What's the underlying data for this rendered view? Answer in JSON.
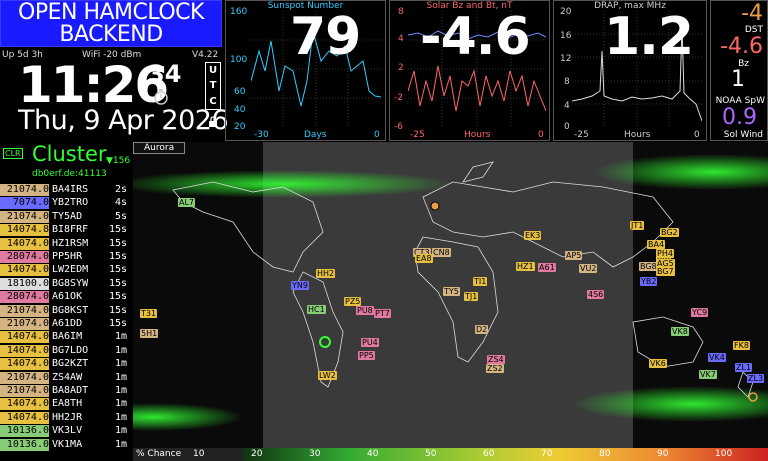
{
  "header": {
    "title_line1": "OPEN HAMCLOCK",
    "title_line2": "BACKEND"
  },
  "status": {
    "uptime": "Up  5d  3h",
    "wifi": "WiFi  -20 dBm",
    "version": "V4.22"
  },
  "clock": {
    "time": "11:26",
    "seconds": "34",
    "date": "Thu, 9 Apr 2026",
    "tz": [
      "U",
      "T",
      "C"
    ]
  },
  "sunspot": {
    "title": "Sunspot Number",
    "value": "79",
    "y_ticks": [
      "160",
      "100",
      "60",
      "40",
      "20"
    ],
    "x_ticks": [
      "-30",
      "Days",
      "0"
    ],
    "chart_data": {
      "type": "line",
      "x": [
        -30,
        -27,
        -24,
        -21,
        -18,
        -15,
        -12,
        -9,
        -6,
        -3,
        0
      ],
      "values": [
        95,
        110,
        140,
        65,
        55,
        100,
        150,
        120,
        110,
        40,
        35
      ],
      "ylim": [
        20,
        160
      ]
    }
  },
  "solarwind_bz": {
    "title": "Solar Bz and Bt, nT",
    "value": "-4.6",
    "y_ticks": [
      "8",
      "4",
      "2",
      "-2",
      "-6"
    ],
    "x_ticks": [
      "-25",
      "Hours",
      "0"
    ],
    "chart_data": {
      "type": "line",
      "series": [
        {
          "values": [
            5,
            5.5,
            4.8,
            5.2,
            5.6,
            5,
            4.9,
            5.3,
            5.1,
            5.4,
            5.2
          ]
        },
        {
          "values": [
            -1,
            2,
            -3,
            0,
            1,
            -4,
            2,
            -2,
            -1,
            0,
            -4.6
          ]
        }
      ],
      "ylim": [
        -6,
        8
      ]
    }
  },
  "drap": {
    "title": "DRAP, max MHz",
    "value": "1.2",
    "y_ticks": [
      "20",
      "16",
      "12",
      "8",
      "4",
      "0"
    ],
    "x_ticks": [
      "-25",
      "Hours",
      "0"
    ],
    "chart_data": {
      "type": "line",
      "values": [
        5,
        6,
        7,
        4,
        14,
        6,
        5,
        4,
        18,
        5,
        1.2
      ],
      "ylim": [
        0,
        20
      ]
    }
  },
  "space_wx": {
    "dst": "-4",
    "dst_label": "DST",
    "bz": "-4.6",
    "bz_label": "Bz",
    "noaa": "1",
    "noaa_label": "NOAA SpW",
    "wind": "0.9",
    "wind_label": "Sol Wind"
  },
  "cluster": {
    "clr": "CLR",
    "title": "Cluster",
    "count": "▼156",
    "host": "db0erf.de:41113",
    "spots": [
      {
        "freq": "21074.0",
        "call": "BA4IRS",
        "age": "2s",
        "color": "#d4b483"
      },
      {
        "freq": "7074.0",
        "call": "YB2TRO",
        "age": "4s",
        "color": "#6b6bff"
      },
      {
        "freq": "21074.0",
        "call": "TY5AD",
        "age": "5s",
        "color": "#d4b483"
      },
      {
        "freq": "14074.8",
        "call": "BI8FRF",
        "age": "15s",
        "color": "#e8c040"
      },
      {
        "freq": "14074.0",
        "call": "HZ1RSM",
        "age": "15s",
        "color": "#e8c040"
      },
      {
        "freq": "28074.0",
        "call": "PP5HR",
        "age": "15s",
        "color": "#e07aa0"
      },
      {
        "freq": "14074.0",
        "call": "LW2EDM",
        "age": "15s",
        "color": "#e8c040"
      },
      {
        "freq": "18100.0",
        "call": "BG8SYW",
        "age": "15s",
        "color": "#dddddd"
      },
      {
        "freq": "28074.0",
        "call": "A61OK",
        "age": "15s",
        "color": "#e07aa0"
      },
      {
        "freq": "21074.0",
        "call": "BG8KST",
        "age": "15s",
        "color": "#d4b483"
      },
      {
        "freq": "21074.0",
        "call": "A61DD",
        "age": "15s",
        "color": "#d4b483"
      },
      {
        "freq": "14074.0",
        "call": "BA6IM",
        "age": "1m",
        "color": "#e8c040"
      },
      {
        "freq": "14074.0",
        "call": "BG7LDO",
        "age": "1m",
        "color": "#e8c040"
      },
      {
        "freq": "14074.0",
        "call": "BG2KZT",
        "age": "1m",
        "color": "#e8c040"
      },
      {
        "freq": "21074.0",
        "call": "ZS4AW",
        "age": "1m",
        "color": "#d4b483"
      },
      {
        "freq": "21074.0",
        "call": "BA8ADT",
        "age": "1m",
        "color": "#d4b483"
      },
      {
        "freq": "14074.0",
        "call": "EA8TH",
        "age": "1m",
        "color": "#e8c040"
      },
      {
        "freq": "14074.0",
        "call": "HH2JR",
        "age": "1m",
        "color": "#e8c040"
      },
      {
        "freq": "10136.0",
        "call": "VK3LV",
        "age": "1m",
        "color": "#88cc77"
      },
      {
        "freq": "10136.0",
        "call": "VK1MA",
        "age": "1m",
        "color": "#88cc77"
      }
    ]
  },
  "map": {
    "mode": "Aurora",
    "labels": [
      {
        "t": "AL7",
        "c": "#88cc77"
      },
      {
        "t": "JT1",
        "c": "#e8c040"
      },
      {
        "t": "BG2",
        "c": "#e8c040"
      },
      {
        "t": "BA4",
        "c": "#e8c040"
      },
      {
        "t": "BG8",
        "c": "#d4b483"
      },
      {
        "t": "BI8",
        "c": "#e8c040"
      },
      {
        "t": "PH4",
        "c": "#e8c040"
      },
      {
        "t": "AG5",
        "c": "#e8c040"
      },
      {
        "t": "BG7",
        "c": "#e8c040"
      },
      {
        "t": "YB2",
        "c": "#6b6bff"
      },
      {
        "t": "YC9",
        "c": "#e07aa0"
      },
      {
        "t": "AP5",
        "c": "#d4b483"
      },
      {
        "t": "VU2",
        "c": "#d4b483"
      },
      {
        "t": "HZ1",
        "c": "#e8c040"
      },
      {
        "t": "A61",
        "c": "#e07aa0"
      },
      {
        "t": "EK3",
        "c": "#e8c040"
      },
      {
        "t": "CT3",
        "c": "#d4b483"
      },
      {
        "t": "CN8",
        "c": "#d4b483"
      },
      {
        "t": "EA8",
        "c": "#e8c040"
      },
      {
        "t": "TY5",
        "c": "#d4b483"
      },
      {
        "t": "TJ1",
        "c": "#e8c040"
      },
      {
        "t": "TI1",
        "c": "#e8c040"
      },
      {
        "t": "D2",
        "c": "#d4b483"
      },
      {
        "t": "ZS4",
        "c": "#e07aa0"
      },
      {
        "t": "ZS2",
        "c": "#d4b483"
      },
      {
        "t": "4S6",
        "c": "#e07aa0"
      },
      {
        "t": "VK8",
        "c": "#88cc77"
      },
      {
        "t": "VK6",
        "c": "#e8c040"
      },
      {
        "t": "FK8",
        "c": "#e8c040"
      },
      {
        "t": "VK4",
        "c": "#6b6bff"
      },
      {
        "t": "VK7",
        "c": "#88cc77"
      },
      {
        "t": "ZL1",
        "c": "#6b6bff"
      },
      {
        "t": "ZL3",
        "c": "#6b6bff"
      },
      {
        "t": "PU8",
        "c": "#e07aa0"
      },
      {
        "t": "PT7",
        "c": "#e07aa0"
      },
      {
        "t": "PU4",
        "c": "#e07aa0"
      },
      {
        "t": "PP5",
        "c": "#e07aa0"
      },
      {
        "t": "LW2",
        "c": "#e8c040"
      },
      {
        "t": "YN9",
        "c": "#6b6bff"
      },
      {
        "t": "HH2",
        "c": "#e8c040"
      },
      {
        "t": "T31",
        "c": "#e8c040"
      },
      {
        "t": "5H1",
        "c": "#d4b483"
      },
      {
        "t": "PZ5",
        "c": "#e8c040"
      },
      {
        "t": "HC1",
        "c": "#88cc77"
      }
    ]
  },
  "legend": {
    "label": "% Chance",
    "ticks": [
      "10",
      "20",
      "30",
      "40",
      "50",
      "60",
      "70",
      "80",
      "90",
      "100"
    ]
  },
  "colors": {
    "title_bg": "#1a1aff",
    "cluster_green": "#33ff33",
    "sunspot_title": "#33ccff",
    "bz_title": "#ff6666",
    "drap_title": "#cccccc"
  }
}
